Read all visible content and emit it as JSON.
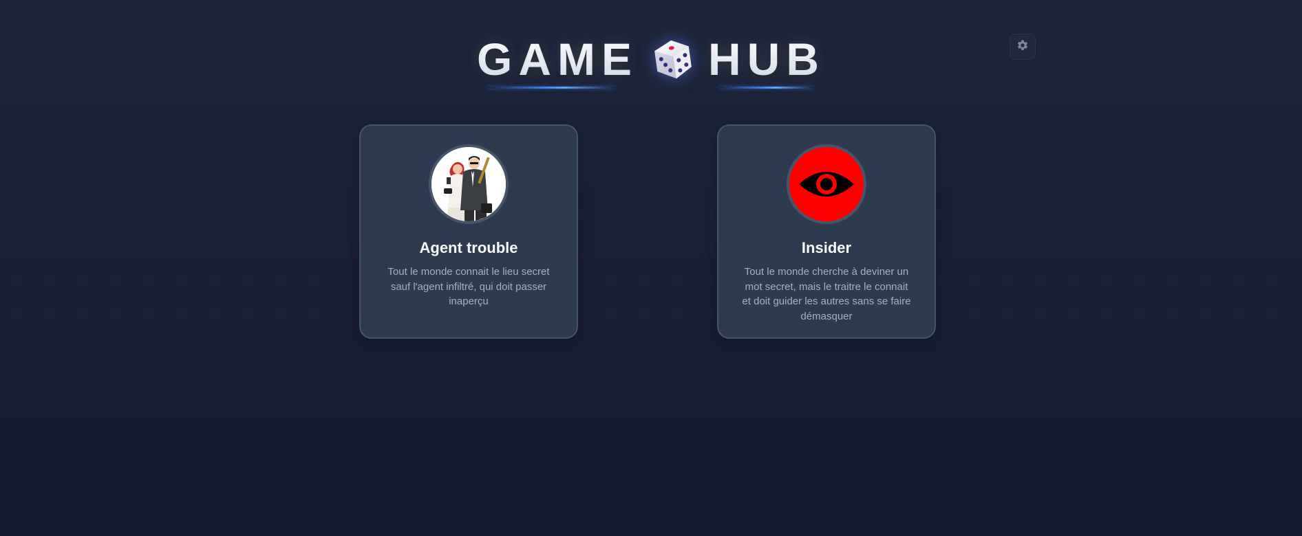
{
  "header": {
    "title_left": "GAME",
    "title_right": "HUB",
    "logo_icon": "dice-icon",
    "settings_icon": "gear-icon"
  },
  "games": [
    {
      "title": "Agent trouble",
      "description": "Tout le monde connait le lieu secret sauf l'agent infiltré, qui doit passer inaperçu",
      "image": "spy-agents-illustration"
    },
    {
      "title": "Insider",
      "description": "Tout le monde cherche à deviner un mot secret, mais le traitre le connait et doit guider les autres sans se faire démasquer",
      "image": "red-eye-icon"
    }
  ],
  "colors": {
    "background": "#1a2234",
    "card": "#2e3a4f",
    "card_border": "#475569",
    "accent": "#3b82f6",
    "insider_red": "#ff0000"
  }
}
